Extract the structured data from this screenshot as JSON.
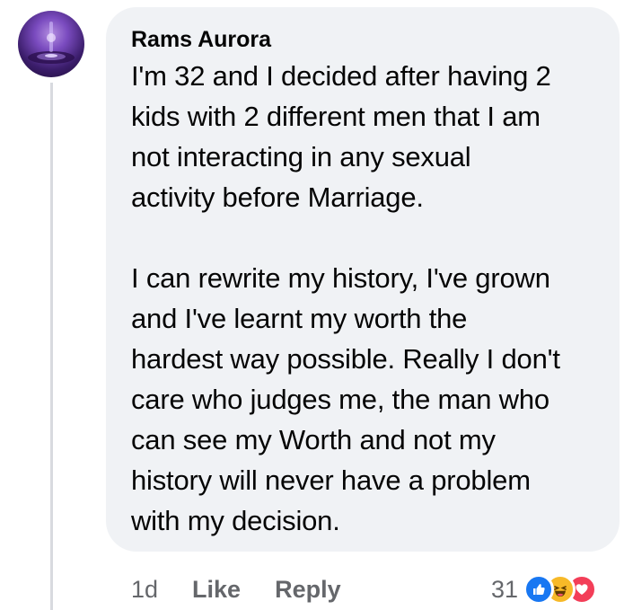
{
  "comment": {
    "author": "Rams Aurora",
    "paragraphs": [
      "I'm 32 and I decided after having 2\nkids with 2 different men that I am\nnot interacting in any sexual\nactivity before Marriage.",
      "I can rewrite my history, I've grown\nand I've learnt my worth the\nhardest way possible. Really I don't\ncare who judges me, the man who\ncan see my Worth and not my\nhistory will never have a problem\nwith my decision."
    ],
    "time": "1d",
    "like_label": "Like",
    "reply_label": "Reply",
    "reaction_count": "31",
    "reaction_icons": [
      "like-icon",
      "haha-icon",
      "love-icon"
    ]
  },
  "colors": {
    "bubble": "#f0f2f5",
    "text": "#050505",
    "secondary_text": "#65676b",
    "like_blue": "#1877f2",
    "haha_yellow": "#f7b928",
    "love_red": "#f33e58",
    "thread_line": "#d8dadf"
  }
}
